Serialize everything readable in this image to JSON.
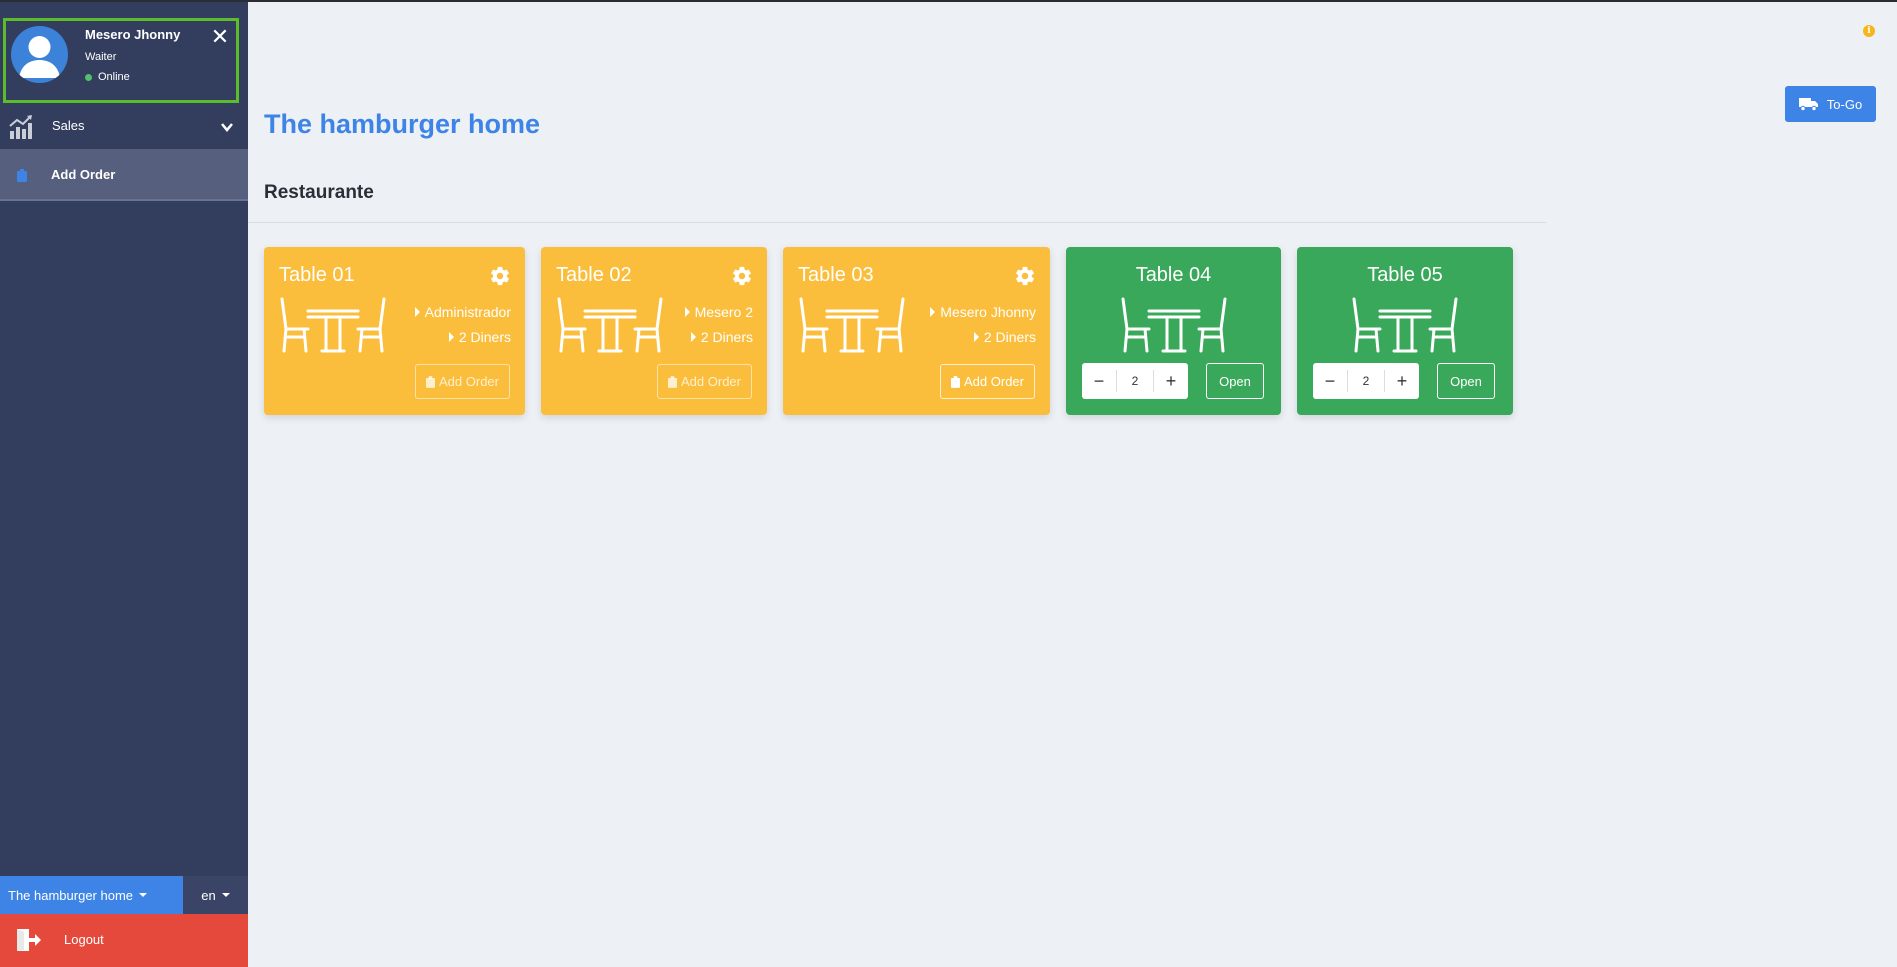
{
  "user": {
    "name": "Mesero Jhonny",
    "role": "Waiter",
    "status": "Online"
  },
  "sidebar": {
    "items": [
      {
        "label": "Sales",
        "icon": "chart-icon"
      },
      {
        "label": "Add Order",
        "icon": "clipboard-icon"
      }
    ],
    "restaurant_selector": "The hamburger home",
    "language_selector": "en",
    "logout_label": "Logout"
  },
  "header": {
    "togo_label": "To-Go"
  },
  "main": {
    "title": "The hamburger home",
    "section": "Restaurante",
    "tables": [
      {
        "name": "Table 01",
        "status": "occupied",
        "waiter": "Administrador",
        "diners": "2 Diners",
        "action": "Add Order"
      },
      {
        "name": "Table 02",
        "status": "occupied",
        "waiter": "Mesero 2",
        "diners": "2 Diners",
        "action": "Add Order"
      },
      {
        "name": "Table 03",
        "status": "occupied",
        "waiter": "Mesero Jhonny",
        "diners": "2 Diners",
        "action": "Add Order"
      },
      {
        "name": "Table 04",
        "status": "free",
        "diners_value": "2",
        "action": "Open"
      },
      {
        "name": "Table 05",
        "status": "free",
        "diners_value": "2",
        "action": "Open"
      }
    ]
  },
  "colors": {
    "sidebar": "#333e5f",
    "accent": "#3d84e6",
    "occupied": "#fbbe3c",
    "free": "#39a85a",
    "logout": "#e5493b",
    "highlight": "#5bbd2b"
  }
}
